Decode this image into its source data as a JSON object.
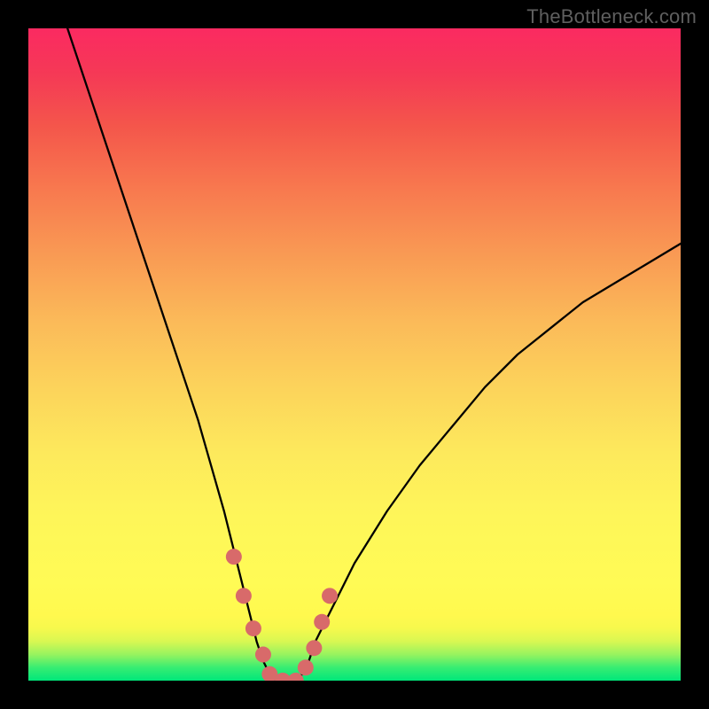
{
  "watermark": "TheBottleneck.com",
  "chart_data": {
    "type": "line",
    "title": "",
    "xlabel": "",
    "ylabel": "",
    "xlim": [
      0,
      100
    ],
    "ylim": [
      0,
      100
    ],
    "series": [
      {
        "name": "bottleneck-curve",
        "x": [
          6,
          8,
          10,
          12,
          14,
          16,
          18,
          20,
          22,
          24,
          26,
          28,
          30,
          31,
          32,
          33,
          34,
          35,
          36,
          37,
          38,
          39,
          40,
          41,
          42,
          43,
          44,
          46,
          48,
          50,
          55,
          60,
          65,
          70,
          75,
          80,
          85,
          90,
          95,
          100
        ],
        "y": [
          100,
          94,
          88,
          82,
          76,
          70,
          64,
          58,
          52,
          46,
          40,
          33,
          26,
          22,
          18,
          14,
          10,
          6,
          3,
          1,
          0,
          0,
          0,
          0,
          1,
          3,
          6,
          10,
          14,
          18,
          26,
          33,
          39,
          45,
          50,
          54,
          58,
          61,
          64,
          67
        ]
      }
    ],
    "markers": {
      "name": "highlight-dots",
      "x": [
        31.5,
        33.0,
        34.5,
        36.0,
        37.0,
        39.0,
        41.0,
        42.5,
        43.8,
        45.0,
        46.2
      ],
      "y": [
        19,
        13,
        8,
        4,
        1,
        0,
        0,
        2,
        5,
        9,
        13
      ]
    },
    "background_gradient": {
      "bottom": "#00e77a",
      "mid": "#fef659",
      "top": "#fb2a61"
    },
    "curve_color": "#000000",
    "marker_color": "#d86a6a"
  }
}
